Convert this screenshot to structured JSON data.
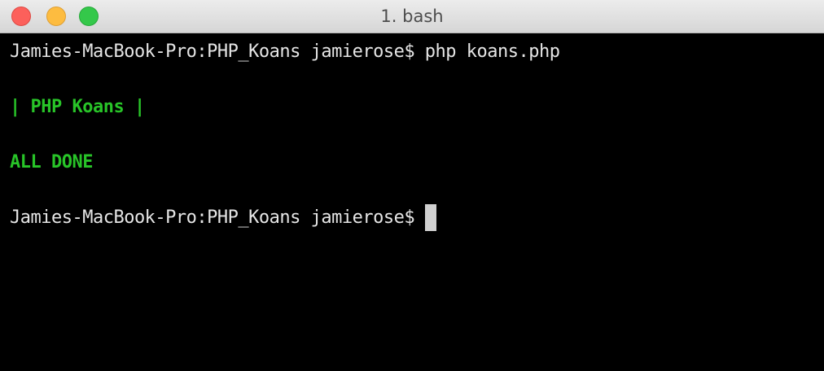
{
  "window": {
    "title": "1. bash"
  },
  "terminal": {
    "lines": [
      {
        "prompt": "Jamies-MacBook-Pro:PHP_Koans jamierose$",
        "command": " php koans.php"
      },
      {
        "output": "| PHP Koans |"
      },
      {
        "output": "ALL DONE"
      },
      {
        "prompt": "Jamies-MacBook-Pro:PHP_Koans jamierose$",
        "command": " "
      }
    ]
  },
  "colors": {
    "background": "#000000",
    "text": "#e5e5e5",
    "success": "#28c428",
    "cursor": "#d0d0d0"
  }
}
